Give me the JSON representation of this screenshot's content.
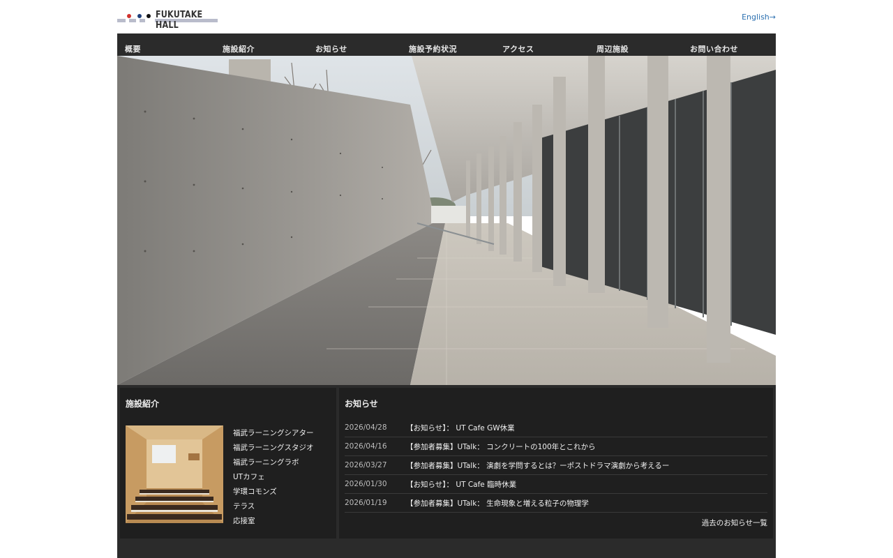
{
  "header": {
    "logo_text": "FUKUTAKE HALL",
    "english_link": "English→"
  },
  "nav": {
    "items": [
      {
        "label": "概要"
      },
      {
        "label": "施設紹介"
      },
      {
        "label": "お知らせ"
      },
      {
        "label": "施設予約状況"
      },
      {
        "label": "アクセス"
      },
      {
        "label": "周辺施設"
      },
      {
        "label": "お問い合わせ"
      }
    ]
  },
  "colors": {
    "nav_bg": "#2b2b2b",
    "panel_bg": "#1f1f1f",
    "link_blue": "#2a6fb0",
    "logo_dot_red": "#d0312d",
    "logo_dot_navy": "#1f3f7a",
    "logo_dot_black": "#111111"
  },
  "facilities": {
    "title": "施設紹介",
    "items": [
      "福武ラーニングシアター",
      "福武ラーニングスタジオ",
      "福武ラーニングラボ",
      "UTカフェ",
      "学環コモンズ",
      "テラス",
      "応接室"
    ]
  },
  "news": {
    "title": "お知らせ",
    "items": [
      {
        "date": "2026/04/28",
        "text": "【お知らせ】： UT Cafe GW休業"
      },
      {
        "date": "2026/04/16",
        "text": "【参加者募集】UTalk： コンクリートの100年とこれから"
      },
      {
        "date": "2026/03/27",
        "text": "【参加者募集】UTalk： 演劇を学問するとは？ーポストドラマ演劇から考えるー"
      },
      {
        "date": "2026/01/30",
        "text": "【お知らせ】： UT Cafe 臨時休業"
      },
      {
        "date": "2026/01/19",
        "text": "【参加者募集】UTalk： 生命現象と増える粒子の物理学"
      }
    ],
    "more_link": "過去のお知らせ一覧"
  }
}
